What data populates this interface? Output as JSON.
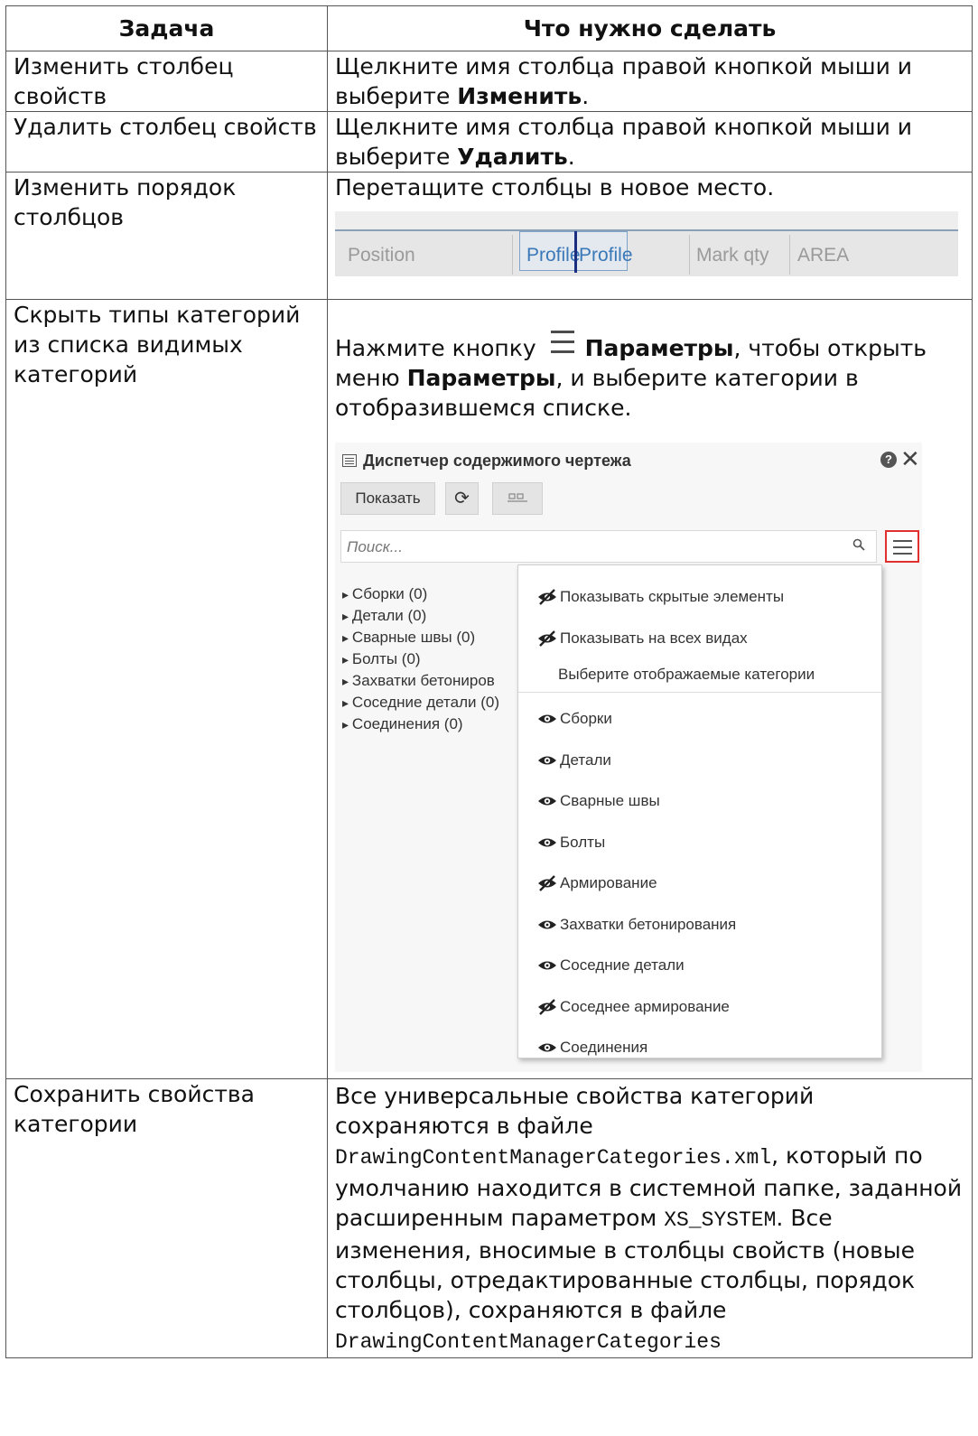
{
  "table": {
    "header": {
      "col1": "Задача",
      "col2": "Что нужно сделать"
    },
    "rows": [
      {
        "task": "Изменить столбец свойств",
        "text": "Щелкните имя столбца правой кнопкой мыши и выберите ",
        "bold": "Изменить",
        "end": "."
      },
      {
        "task": "Удалить столбец свойств",
        "text": "Щелкните имя столбца правой кнопкой мыши и выберите ",
        "bold": "Удалить",
        "end": "."
      },
      {
        "task": "Изменить порядок столбцов",
        "text": "Перетащите столбцы в новое место."
      },
      {
        "task": "Скрыть типы категорий из списка видимых категорий",
        "t1": "Нажмите кнопку ",
        "b1": "Параметры",
        "t2": ", чтобы открыть меню ",
        "b2": "Параметры",
        "t3": ", и выберите категории в отобразившемся списке."
      },
      {
        "task": "Сохранить свойства категории",
        "t1": "Все универсальные свойства категорий сохраняются в файле ",
        "code1": "DrawingContentManagerCategories.xml",
        "t2": ", который по умолчанию находится в системной папке, заданной расширенным параметром ",
        "code2": "XS_SYSTEM",
        "t3": ". Все изменения, вносимые в столбцы свойств (новые столбцы, отредактированные столбцы, порядок столбцов), сохраняются в файле ",
        "code3": "DrawingContentManagerCategories"
      }
    ]
  },
  "column_strip": {
    "headers": [
      "Position",
      "Mark qty",
      "AREA"
    ],
    "dragged_ghost": "Profile",
    "dragged_label": "Profile"
  },
  "panel": {
    "title": "Диспетчер содержимого чертежа",
    "help_icon": "?",
    "close_icon": "✕",
    "show_button": "Показать",
    "refresh_icon": "⟳",
    "search_placeholder": "Поиск...",
    "tree": [
      "Сборки (0)",
      "Детали (0)",
      "Сварные швы (0)",
      "Болты (0)",
      "Захватки бетониров",
      "Соседние детали (0)",
      "Соединения (0)"
    ],
    "menu_top": [
      {
        "label": "Показывать скрытые элементы",
        "visible": false
      },
      {
        "label": "Показывать на всех видах",
        "visible": false
      }
    ],
    "menu_heading": "Выберите отображаемые категории",
    "categories": [
      {
        "label": "Сборки",
        "visible": true
      },
      {
        "label": "Детали",
        "visible": true
      },
      {
        "label": "Сварные швы",
        "visible": true
      },
      {
        "label": "Болты",
        "visible": true
      },
      {
        "label": "Армирование",
        "visible": false
      },
      {
        "label": "Захватки бетонирования",
        "visible": true
      },
      {
        "label": "Соседние детали",
        "visible": true
      },
      {
        "label": "Соседнее армирование",
        "visible": false
      },
      {
        "label": "Соединения",
        "visible": true
      }
    ],
    "icons": {
      "menu": "hamburger-icon",
      "eye": "eye-icon",
      "eye_off": "eye-off-icon"
    },
    "highlight_color": "#e03030"
  }
}
